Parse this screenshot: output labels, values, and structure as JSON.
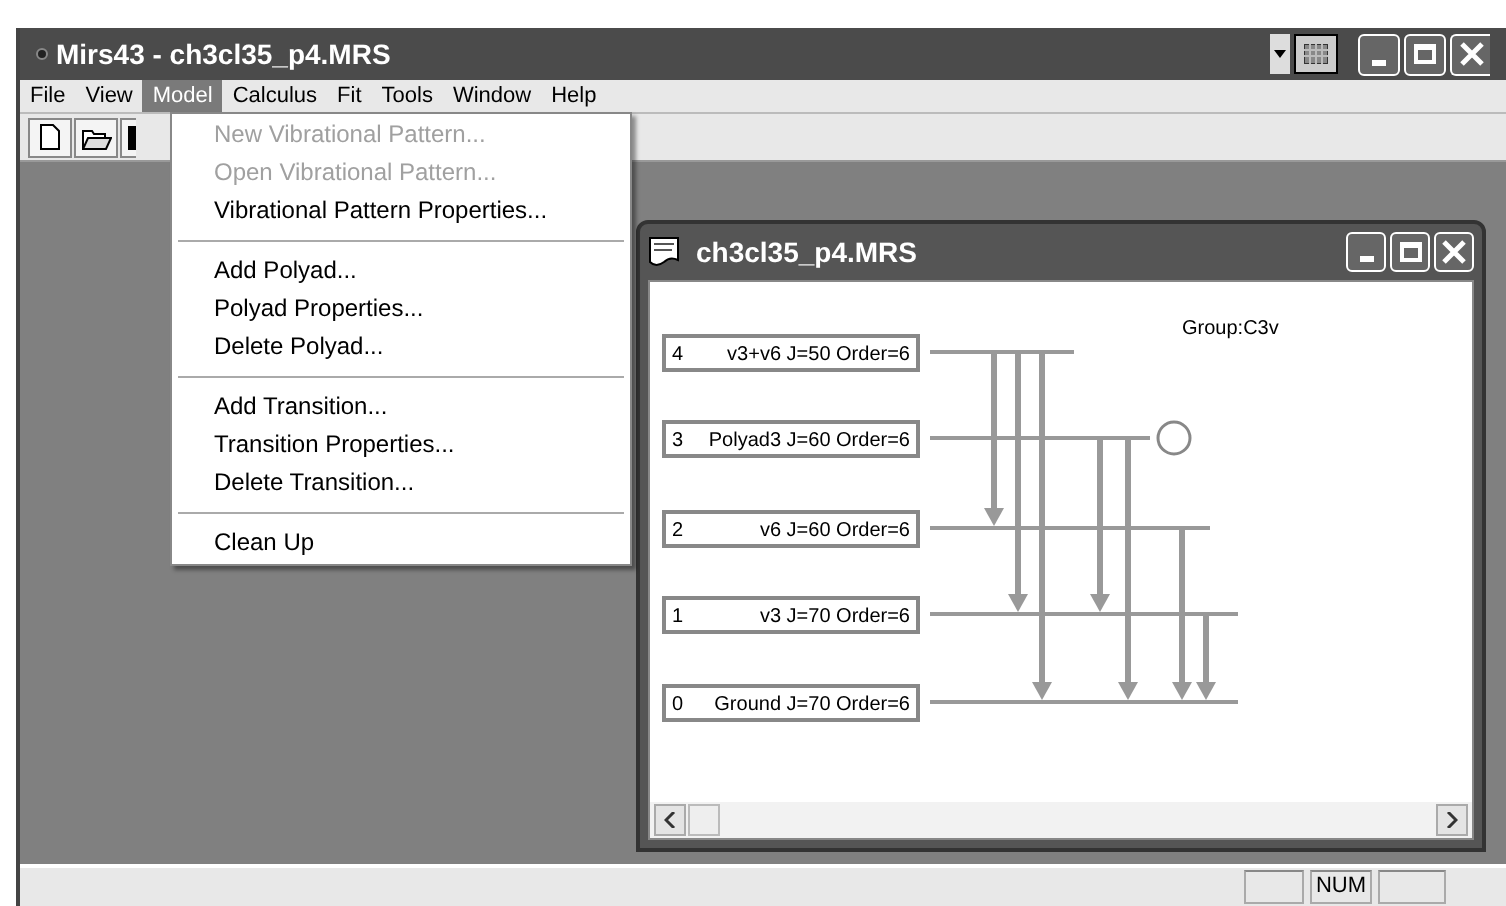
{
  "window": {
    "title": "Mirs43 - ch3cl35_p4.MRS"
  },
  "menu_bar": [
    {
      "label": "File",
      "selected": false
    },
    {
      "label": "View",
      "selected": false
    },
    {
      "label": "Model",
      "selected": true
    },
    {
      "label": "Calculus",
      "selected": false
    },
    {
      "label": "Fit",
      "selected": false
    },
    {
      "label": "Tools",
      "selected": false
    },
    {
      "label": "Window",
      "selected": false
    },
    {
      "label": "Help",
      "selected": false
    }
  ],
  "model_menu": {
    "groups": [
      [
        {
          "label": "New Vibrational Pattern...",
          "disabled": true
        },
        {
          "label": "Open Vibrational Pattern...",
          "disabled": true
        },
        {
          "label": "Vibrational Pattern Properties...",
          "disabled": false
        }
      ],
      [
        {
          "label": "Add Polyad...",
          "disabled": false
        },
        {
          "label": "Polyad Properties...",
          "disabled": false
        },
        {
          "label": "Delete Polyad...",
          "disabled": false
        }
      ],
      [
        {
          "label": "Add Transition...",
          "disabled": false
        },
        {
          "label": "Transition Properties...",
          "disabled": false
        },
        {
          "label": "Delete Transition...",
          "disabled": false
        }
      ],
      [
        {
          "label": "Clean Up",
          "disabled": false
        }
      ]
    ]
  },
  "document_window": {
    "title": "ch3cl35_p4.MRS",
    "group": "Group:C3v",
    "levels": [
      {
        "index": "4",
        "label": "v3+v6 J=50 Order=6"
      },
      {
        "index": "3",
        "label": "Polyad3 J=60 Order=6"
      },
      {
        "index": "2",
        "label": "v6 J=60 Order=6"
      },
      {
        "index": "1",
        "label": "v3 J=70 Order=6"
      },
      {
        "index": "0",
        "label": "Ground J=70 Order=6"
      }
    ]
  },
  "status_bar": {
    "indicators": [
      "NUM"
    ]
  }
}
